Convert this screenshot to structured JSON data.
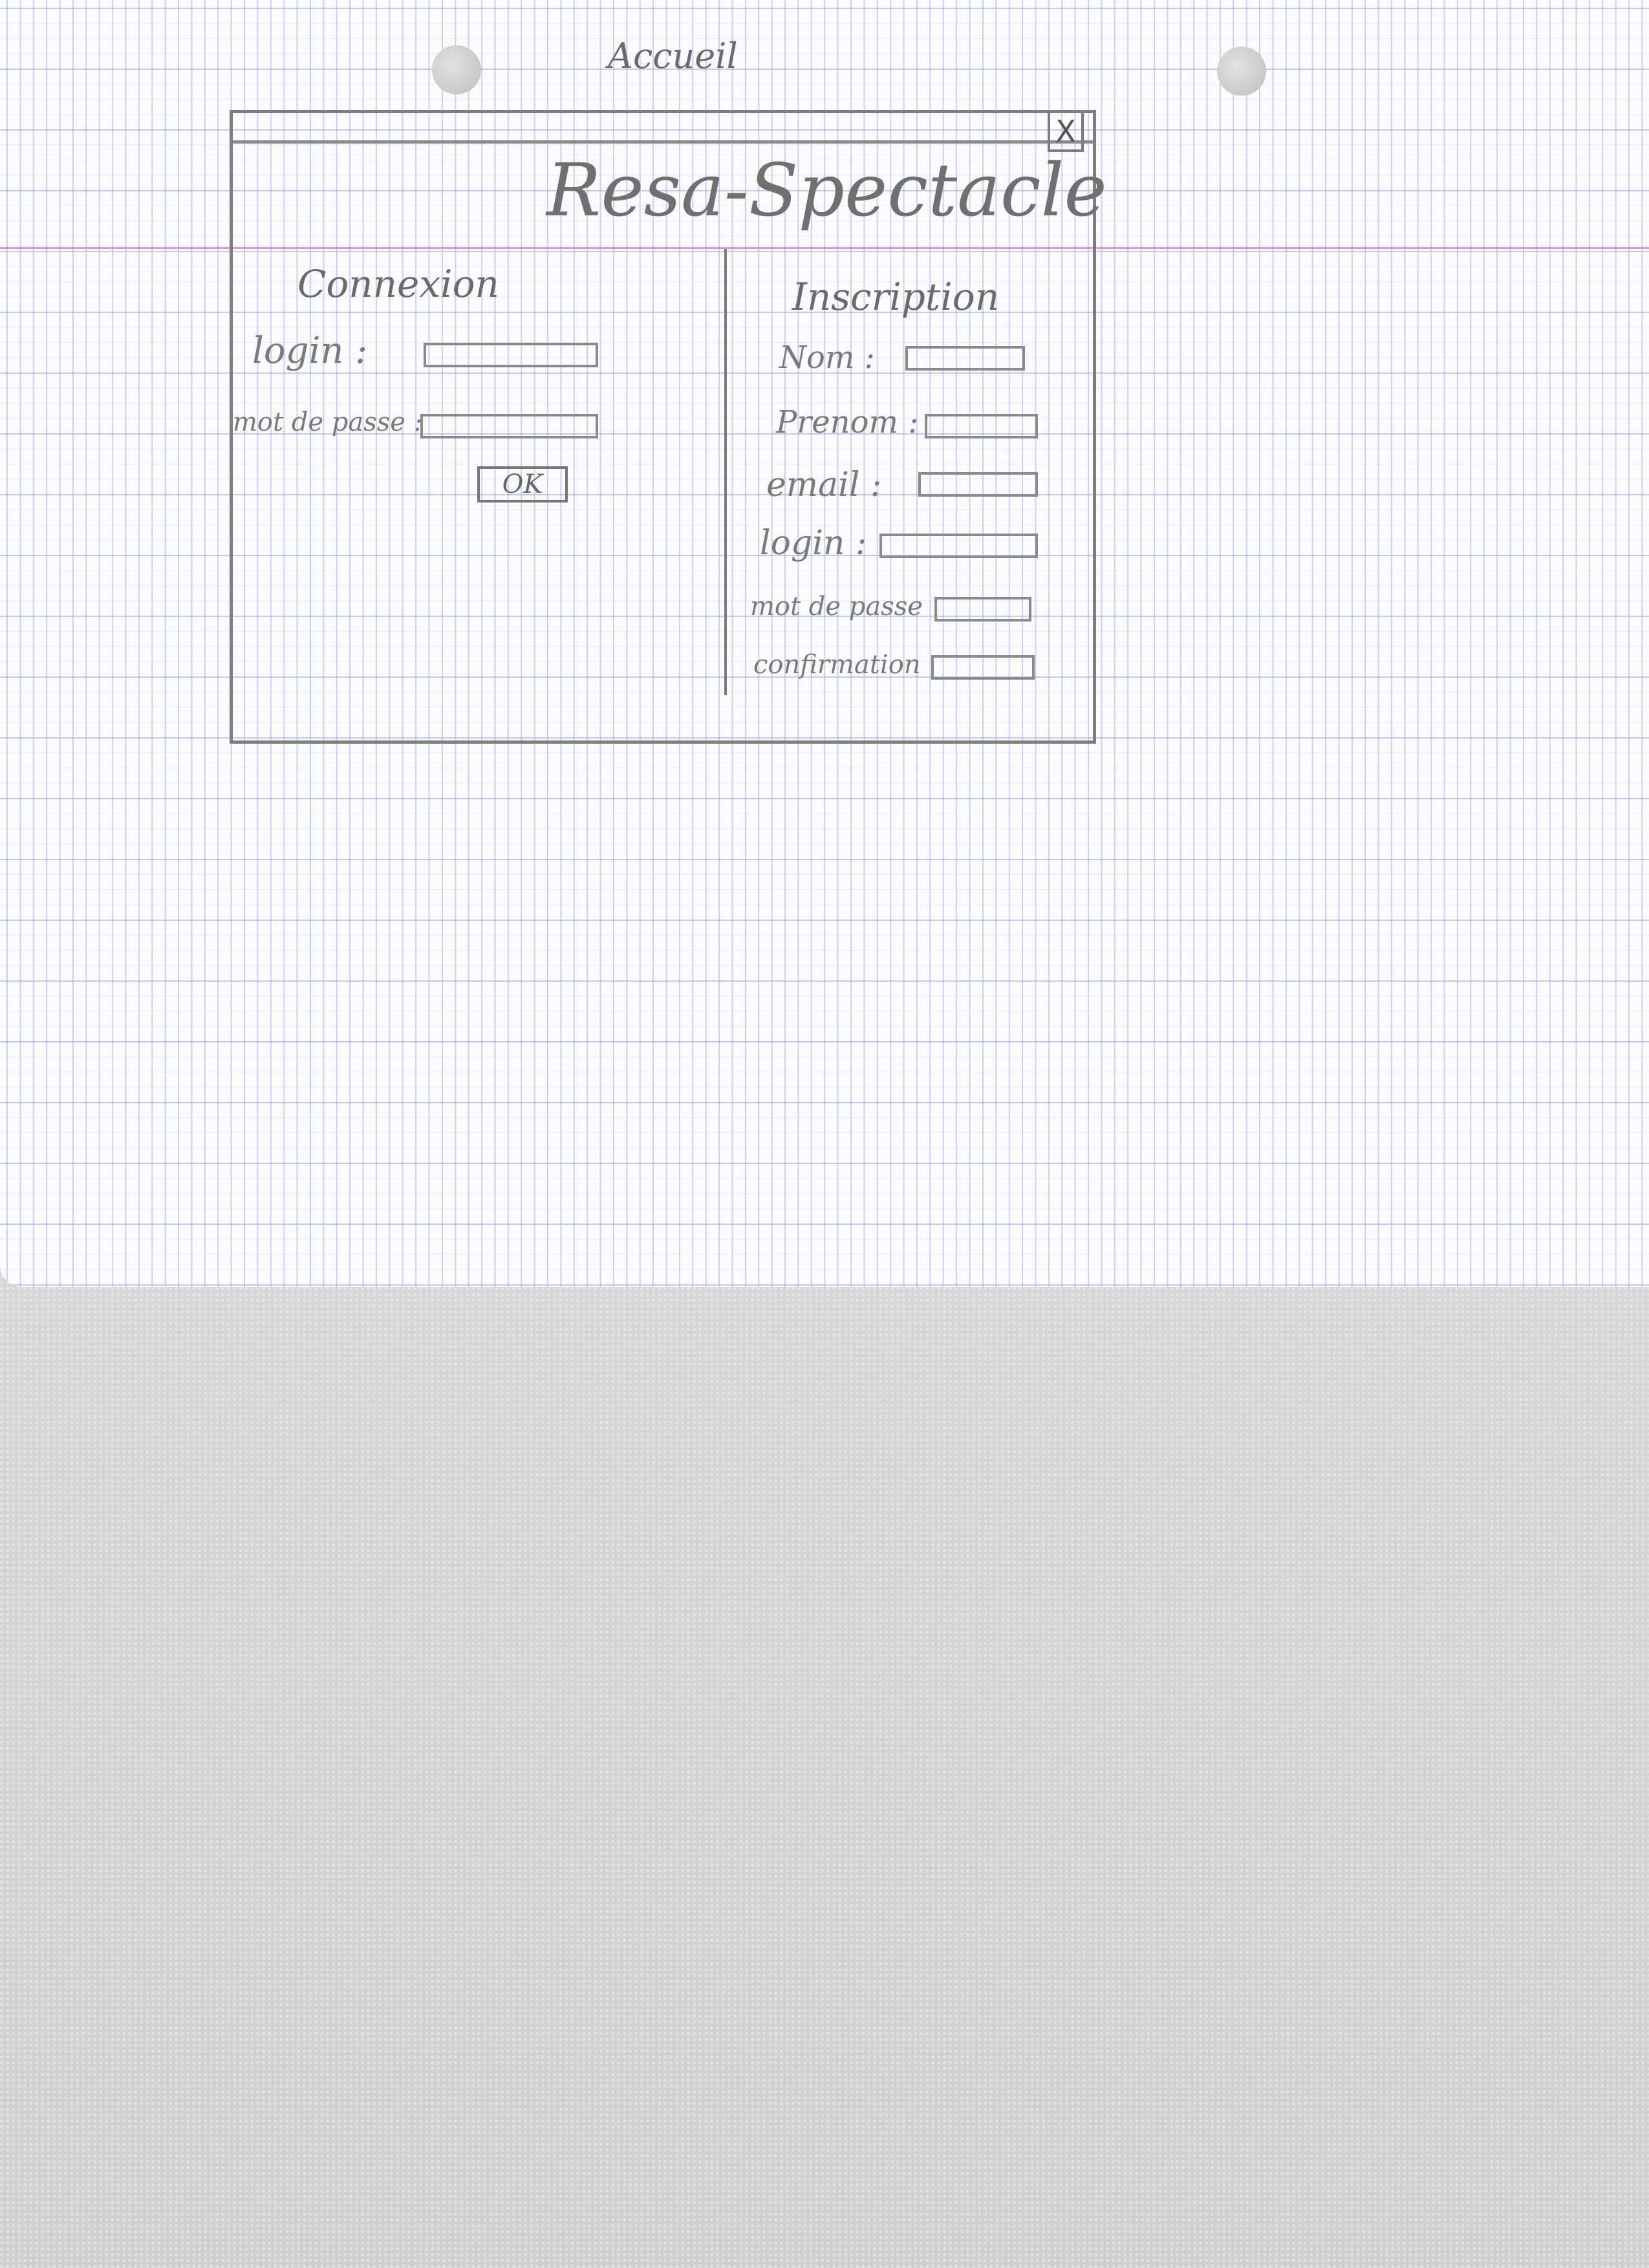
{
  "page": {
    "caption": "Accueil"
  },
  "window": {
    "title": "Resa-Spectacle",
    "close_label": "X"
  },
  "connexion": {
    "title": "Connexion",
    "fields": {
      "login": {
        "label": "login :"
      },
      "password": {
        "label": "mot de passe :"
      }
    },
    "ok_label": "OK"
  },
  "inscription": {
    "title": "Inscription",
    "fields": {
      "nom": {
        "label": "Nom :"
      },
      "prenom": {
        "label": "Prenom :"
      },
      "email": {
        "label": "email :"
      },
      "login": {
        "label": "login :"
      },
      "password": {
        "label": "mot de passe"
      },
      "confirmation": {
        "label": "confirmation"
      }
    }
  }
}
